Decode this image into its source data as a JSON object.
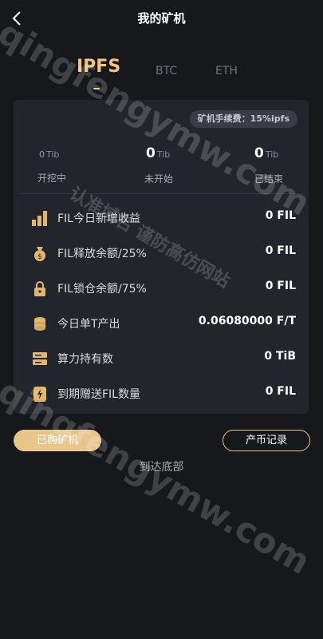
{
  "header": {
    "title": "我的矿机"
  },
  "tabs": [
    {
      "label": "IPFS"
    },
    {
      "label": "BTC"
    },
    {
      "label": "ETH"
    }
  ],
  "card": {
    "fee": "矿机手续费：15%ipfs",
    "stats": [
      {
        "value": "0",
        "unit": "Tib",
        "label": "开挖中"
      },
      {
        "value": "0",
        "unit": "Tib",
        "label": "未开始"
      },
      {
        "value": "0",
        "unit": "Tib",
        "label": "已结束"
      }
    ],
    "rows": [
      {
        "icon": "bar-chart-icon",
        "label": "FIL今日新增收益",
        "value": "0 FIL"
      },
      {
        "icon": "money-bag-icon",
        "label": "FIL释放余额/25%",
        "value": "0 FIL"
      },
      {
        "icon": "lock-icon",
        "label": "FIL锁仓余额/75%",
        "value": "0 FIL"
      },
      {
        "icon": "coin-stack-icon",
        "label": "今日单T产出",
        "value": "0.06080000 F/T"
      },
      {
        "icon": "server-icon",
        "label": "算力持有数",
        "value": "0 TiB"
      },
      {
        "icon": "gift-icon",
        "label": "到期赠送FIL数量",
        "value": "0 FIL"
      }
    ]
  },
  "actions": {
    "purchased": "已购矿机",
    "records": "产币记录"
  },
  "footer": {
    "end_text": "到达底部"
  },
  "watermarks": {
    "site_a": "qingfengymw.com",
    "site_b": "认准域名 谨防高仿网站"
  },
  "colors": {
    "background": "#17181c",
    "card": "#23252d",
    "accent": "#f2c37a"
  }
}
